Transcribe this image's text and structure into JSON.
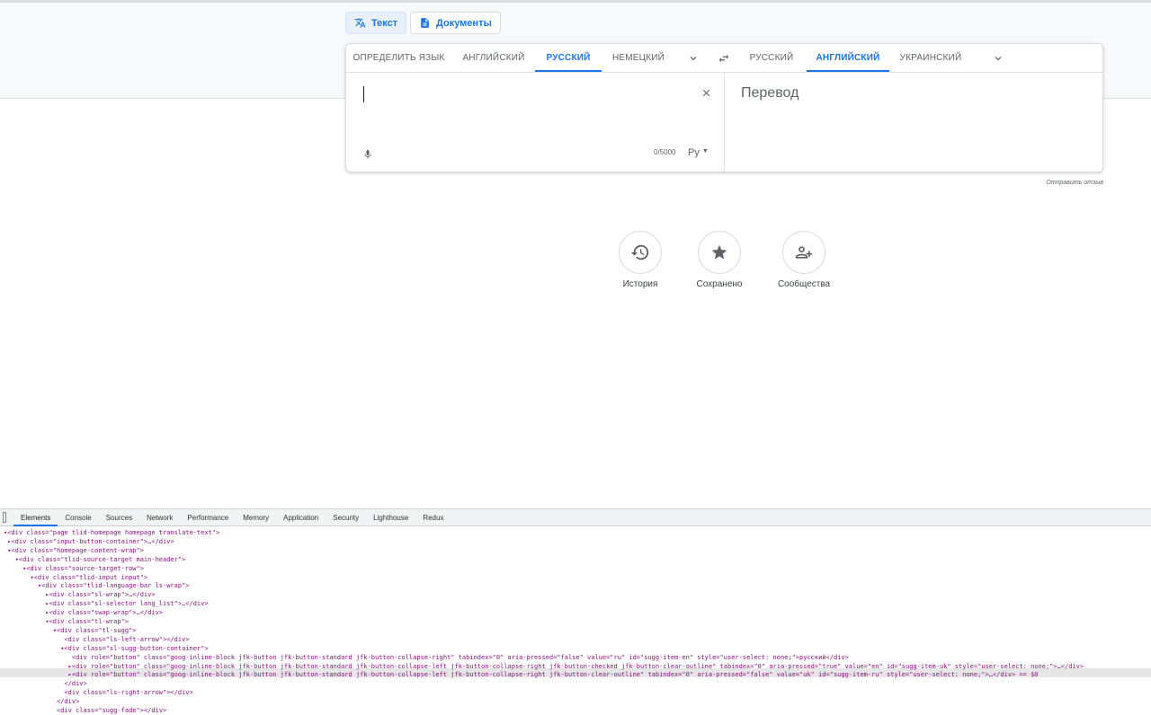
{
  "modes": {
    "text": "Текст",
    "documents": "Документы"
  },
  "source_langs": [
    "ОПРЕДЕЛИТЬ ЯЗЫК",
    "АНГЛИЙСКИЙ",
    "РУССКИЙ",
    "НЕМЕЦКИЙ"
  ],
  "target_langs": [
    "РУССКИЙ",
    "АНГЛИЙСКИЙ",
    "УКРАИНСКИЙ"
  ],
  "source_selected": "РУССКИЙ",
  "target_selected": "АНГЛИЙСКИЙ",
  "input": {
    "value": "",
    "counter": "0/5000",
    "translit": "Ру"
  },
  "output": {
    "placeholder": "Перевод"
  },
  "feedback": "Отправить отзыв",
  "quick_actions": [
    {
      "icon": "history-icon",
      "label": "История"
    },
    {
      "icon": "star-icon",
      "label": "Сохранено"
    },
    {
      "icon": "community-icon",
      "label": "Сообщества"
    }
  ],
  "devtools": {
    "tabs": [
      "Elements",
      "Console",
      "Sources",
      "Network",
      "Performance",
      "Memory",
      "Application",
      "Security",
      "Lighthouse",
      "Redux"
    ],
    "active_tab": "Elements",
    "lines": [
      "▾<div class=\"page tlid-homepage homepage translate-text\">",
      " ▸<div class=\"input-button-container\">…</div>",
      " ▾<div class=\"homepage-content-wrap\">",
      "   ▾<div class=\"tlid-source-target main-header\">",
      "     ▾<div class=\"source-target-row\">",
      "       ▾<div class=\"tlid-input input\">",
      "         ▾<div class=\"tlid-language-bar ls-wrap\">",
      "           ▸<div class=\"sl-wrap\">…</div>",
      "           ▸<div class=\"sl-selector lang_list\">…</div>",
      "           ▸<div class=\"swap-wrap\">…</div>",
      "           ▾<div class=\"tl-wrap\">",
      "             ▾<div class=\"tl-sugg\">",
      "                <div class=\"ls-left-arrow\"></div>",
      "               ▾<div class=\"sl-sugg-button-container\">",
      "                  <div role=\"button\" class=\"goog-inline-block jfk-button jfk-button-standard jfk-button-collapse-right\" tabindex=\"0\" aria-pressed=\"false\" value=\"ru\" id=\"sugg-item-en\" style=\"user-select: none;\">русский</div>",
      "                 ▸<div role=\"button\" class=\"goog-inline-block jfk-button jfk-button-standard jfk-button-collapse-left jfk-button-collapse-right jfk-button-checked jfk-button-clear-outline\" tabindex=\"0\" aria-pressed=\"true\" value=\"en\" id=\"sugg-item-uk\" style=\"user-select: none;\">…</div>",
      "                 ▸<div role=\"button\" class=\"goog-inline-block jfk-button jfk-button-standard jfk-button-collapse-left jfk-button-collapse-right jfk-button-clear-outline\" tabindex=\"0\" aria-pressed=\"false\" value=\"uk\" id=\"sugg-item-ru\" style=\"user-select: none;\">…</div> == $0",
      "                </div>",
      "                <div class=\"ls-right-arrow\"></div>",
      "              </div>",
      "              <div class=\"sugg-fade\"></div>"
    ]
  }
}
